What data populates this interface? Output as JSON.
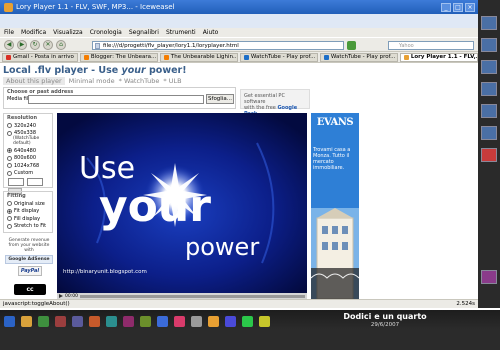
{
  "window": {
    "title": "Lory Player 1.1 - FLV, SWF, MP3... - Iceweasel",
    "buttons": [
      "_",
      "□",
      "×"
    ]
  },
  "menu": [
    "File",
    "Modifica",
    "Visualizza",
    "Cronologia",
    "Segnalibri",
    "Strumenti",
    "Aiuto"
  ],
  "nav": {
    "back": "◀",
    "forward": "▶",
    "reload": "↻",
    "stop": "✕",
    "home": "⌂",
    "url": "file:///d/progetti/flv_player/lory1.1/loryplayer.html",
    "search_placeholder": "Yahoo"
  },
  "tabs": [
    {
      "label": "Gmail - Posta in arrivo",
      "color": "#d93025"
    },
    {
      "label": "Blogger: The Unbeara...",
      "color": "#f57d00"
    },
    {
      "label": "The Unbearable Lighin...",
      "color": "#f57d00"
    },
    {
      "label": "WatchTube - Play prof...",
      "color": "#1c6ec7"
    },
    {
      "label": "WatchTube - Play prof...",
      "color": "#1c6ec7"
    },
    {
      "label": "Lory Player 1.1 - FLV,...",
      "color": "#e8a033",
      "active": true
    }
  ],
  "page": {
    "title_pre": "Local .flv player - Use ",
    "title_em": "your",
    "title_post": " power!",
    "navlinks": [
      "About this player",
      "Minimal mode",
      "* WatchTube",
      "* ULB"
    ],
    "choose_title": "Choose or past address",
    "media_label": "Media file:",
    "browse": "Sfoglia...",
    "gpack_line1": "Get essential PC software",
    "gpack_line2": "with the free ",
    "gpack_link": "Google Pack."
  },
  "resolution": {
    "title": "Resolution",
    "options": [
      {
        "label": "320x240",
        "checked": false
      },
      {
        "label": "450x338",
        "checked": false,
        "sub": "(WatchTube default)"
      },
      {
        "label": "640x480",
        "checked": true
      },
      {
        "label": "800x600",
        "checked": false
      },
      {
        "label": "1024x768",
        "checked": false
      },
      {
        "label": "Custom",
        "checked": false
      }
    ]
  },
  "fitting": {
    "title": "Fitting",
    "options": [
      {
        "label": "Original size",
        "checked": false
      },
      {
        "label": "Fit display",
        "checked": true
      },
      {
        "label": "Fill display",
        "checked": false
      },
      {
        "label": "Stretch to Fit",
        "checked": false
      }
    ]
  },
  "generate": {
    "line1": "Generate revenue",
    "line2": "from your website with",
    "adsense": "Google AdSense"
  },
  "paypal": "PayPal",
  "cc": "cc",
  "player": {
    "word_use": "Use",
    "word_your": "your",
    "word_power": "power",
    "url": "http://binaryunit.blogspot.com",
    "time": "00:00"
  },
  "ad": {
    "brand": "EVANS",
    "copy": "Trovami casa a Monza. Tutto il mercato immobiliare."
  },
  "statusbar": {
    "left": "javascript:toggleAbout()",
    "right": "2.524s"
  },
  "taskbar": {
    "clock": "Dodici e un quarto",
    "date": "29/6/2007"
  },
  "colors": {
    "title_blue": "#3a5f8a",
    "titlebar": "#215fb9",
    "player_bg": "#0a1a7a"
  }
}
